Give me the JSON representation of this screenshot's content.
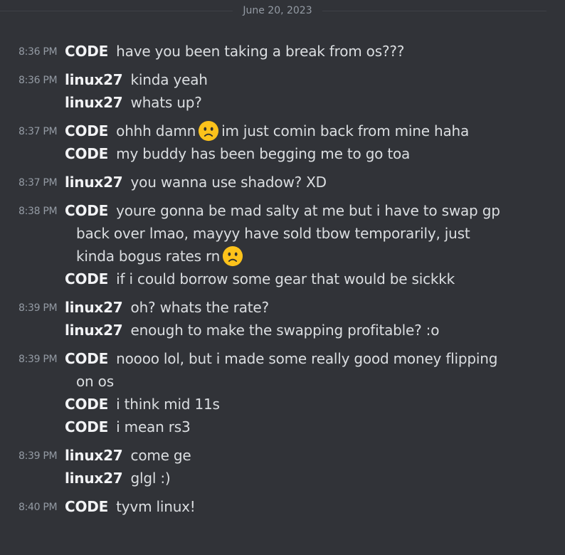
{
  "divider": {
    "date": "June 20, 2023"
  },
  "messages": [
    {
      "time": "8:36 PM",
      "author": "CODE",
      "parts": [
        "have you been taking a break from os???"
      ]
    },
    {
      "time": "8:36 PM",
      "author": "linux27",
      "parts": [
        "kinda yeah"
      ]
    },
    {
      "time": "",
      "author": "linux27",
      "parts": [
        "whats up?"
      ]
    },
    {
      "time": "8:37 PM",
      "author": "CODE",
      "parts": [
        "ohhh damn",
        "im just comin back from mine haha"
      ],
      "emoji": "frowning-face-emoji"
    },
    {
      "time": "",
      "author": "CODE",
      "parts": [
        "my buddy has been begging me to go toa"
      ]
    },
    {
      "time": "8:37 PM",
      "author": "linux27",
      "parts": [
        "you wanna use shadow? XD"
      ]
    },
    {
      "time": "8:38 PM",
      "author": "CODE",
      "parts": [
        "youre gonna be mad salty at me but i have to swap gp",
        "back over lmao, mayyy have sold tbow temporarily, just",
        "kinda bogus rates rn"
      ],
      "emoji": "frowning-face-emoji"
    },
    {
      "time": "",
      "author": "CODE",
      "parts": [
        "if i could borrow some gear that would be sickkk"
      ]
    },
    {
      "time": "8:39 PM",
      "author": "linux27",
      "parts": [
        "oh? whats the rate?"
      ]
    },
    {
      "time": "",
      "author": "linux27",
      "parts": [
        "enough to make the swapping profitable? :o"
      ]
    },
    {
      "time": "8:39 PM",
      "author": "CODE",
      "parts": [
        "noooo lol, but i made some really good money flipping",
        "on os"
      ]
    },
    {
      "time": "",
      "author": "CODE",
      "parts": [
        "i think mid 11s"
      ]
    },
    {
      "time": "",
      "author": "CODE",
      "parts": [
        "i mean rs3"
      ]
    },
    {
      "time": "8:39 PM",
      "author": "linux27",
      "parts": [
        "come ge"
      ]
    },
    {
      "time": "",
      "author": "linux27",
      "parts": [
        "glgl :)"
      ]
    },
    {
      "time": "8:40 PM",
      "author": "CODE",
      "parts": [
        "tyvm linux!"
      ]
    }
  ]
}
